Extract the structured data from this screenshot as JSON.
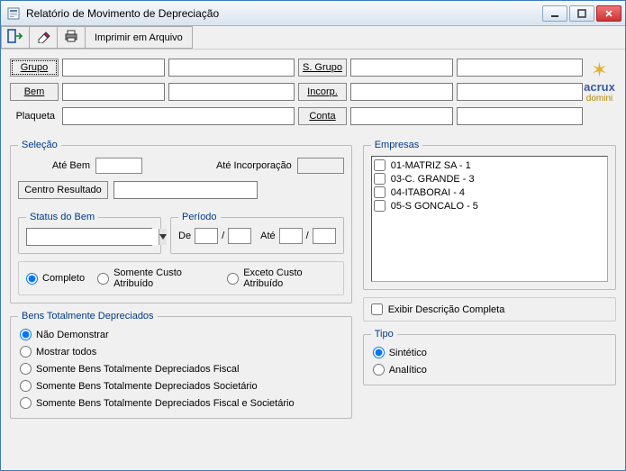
{
  "window": {
    "title": "Relatório de Movimento de Depreciação"
  },
  "toolbar": {
    "print_file_label": "Imprimir em Arquivo"
  },
  "topgrid": {
    "grupo_btn": "Grupo",
    "sgrupo_btn": "S. Grupo",
    "bem_btn": "Bem",
    "incorp_btn": "Incorp.",
    "plaqueta_label": "Plaqueta",
    "conta_btn": "Conta"
  },
  "logo": {
    "brand": "acrux",
    "sub": "domini"
  },
  "selecao": {
    "legend": "Seleção",
    "ate_bem_label": "Até Bem",
    "ate_incorp_label": "Até Incorporação",
    "centro_resultado_btn": "Centro Resultado",
    "status": {
      "legend": "Status do Bem"
    },
    "periodo": {
      "legend": "Período",
      "de": "De",
      "ate": "Até",
      "slash": "/"
    },
    "radios": {
      "completo": "Completo",
      "somente_custo": "Somente Custo Atribuído",
      "exceto_custo": "Exceto Custo Atribuído"
    }
  },
  "empresas": {
    "legend": "Empresas",
    "items": [
      "01-MATRIZ SA - 1",
      "03-C. GRANDE - 3",
      "04-ITABORAI - 4",
      "05-S GONCALO - 5"
    ]
  },
  "bens_dep": {
    "legend": "Bens Totalmente Depreciados",
    "options": [
      "Não Demonstrar",
      "Mostrar todos",
      "Somente Bens Totalmente Depreciados Fiscal",
      "Somente Bens Totalmente Depreciados Societário",
      "Somente Bens Totalmente Depreciados Fiscal e Societário"
    ]
  },
  "exibir_desc": "Exibir Descrição Completa",
  "tipo": {
    "legend": "Tipo",
    "sintetico": "Sintético",
    "analitico": "Analítico"
  }
}
